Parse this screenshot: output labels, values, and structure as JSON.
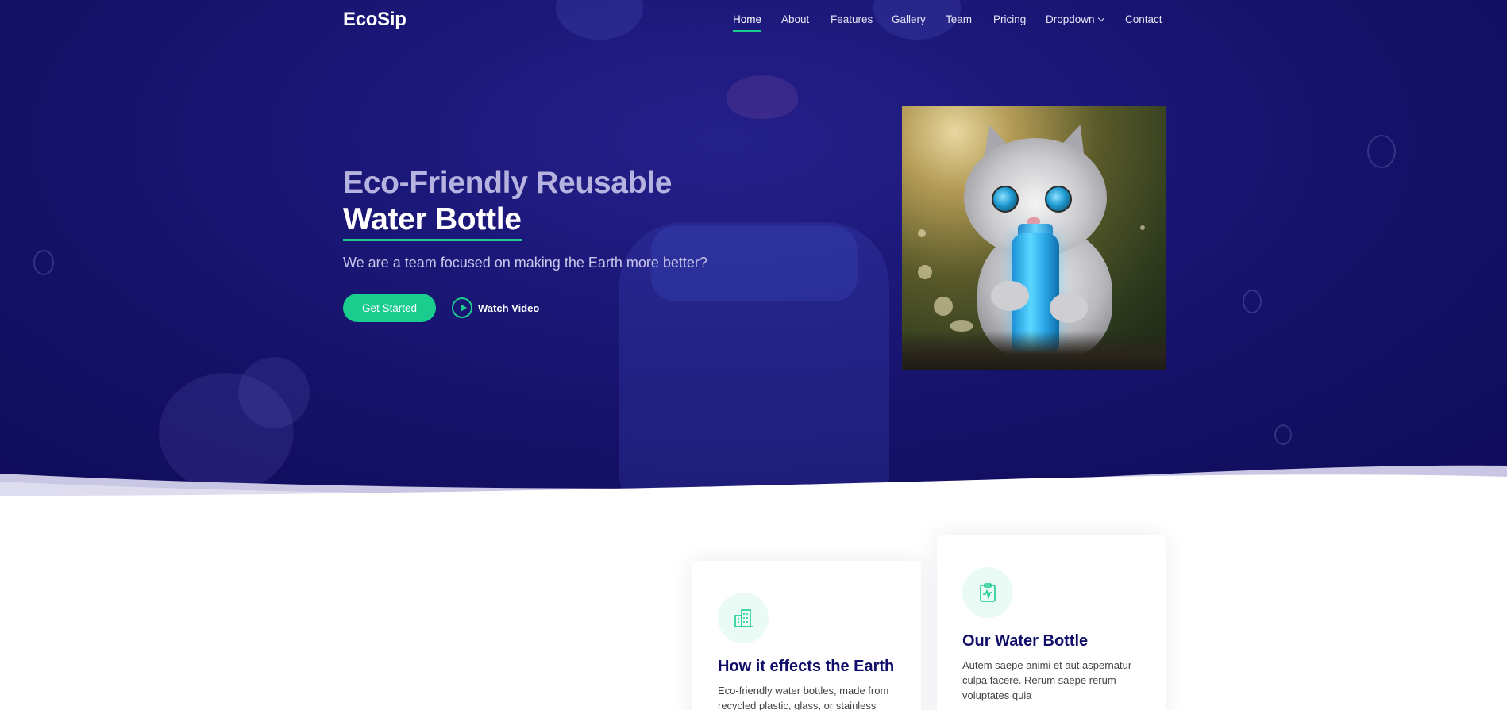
{
  "brand": {
    "logo": "EcoSip",
    "accent": "#1acc8d",
    "hero_bg": "#130f63",
    "heading_color": "#0f0c6a"
  },
  "nav": {
    "items": [
      {
        "label": "Home",
        "active": true
      },
      {
        "label": "About"
      },
      {
        "label": "Features"
      },
      {
        "label": "Gallery"
      },
      {
        "label": "Team"
      },
      {
        "label": "Pricing"
      },
      {
        "label": "Dropdown",
        "icon": "chevron-down-icon"
      },
      {
        "label": "Contact"
      }
    ]
  },
  "hero": {
    "title_line1": "Eco-Friendly Reusable",
    "title_line2": "Water Bottle",
    "subtitle": "We are a team focused on making the Earth more better?",
    "cta_primary": "Get Started",
    "cta_secondary": "Watch Video",
    "cta_secondary_icon": "play-circle-icon",
    "image_subject": "kitten-with-blue-water-bottle"
  },
  "cards": [
    {
      "icon": "building-icon",
      "title": "How it effects the Earth",
      "text": "Eco-friendly water bottles, made from recycled plastic, glass, or stainless"
    },
    {
      "icon": "clipboard-pulse-icon",
      "title": "Our Water Bottle",
      "text": "Autem saepe animi et aut aspernatur culpa facere. Rerum saepe rerum voluptates quia"
    }
  ]
}
